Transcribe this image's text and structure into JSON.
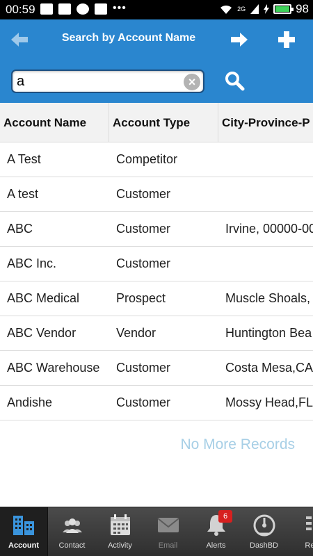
{
  "status_bar": {
    "time": "00:59",
    "signal_text": "2G",
    "battery_percent": "98",
    "battery_level": 0.98
  },
  "header": {
    "title": "Search by Account Name",
    "back_icon": "arrow-left-icon",
    "forward_icon": "arrow-right-icon",
    "add_icon": "plus-icon"
  },
  "search": {
    "value": "a",
    "clear_icon": "clear-icon",
    "search_icon": "search-icon"
  },
  "table": {
    "columns": [
      "Account Name",
      "Account Type",
      "City-Province-P"
    ],
    "rows": [
      {
        "name": "A Test",
        "type": "Competitor",
        "city": ""
      },
      {
        "name": "A test",
        "type": "Customer",
        "city": ""
      },
      {
        "name": "ABC",
        "type": "Customer",
        "city": "Irvine, 00000-00"
      },
      {
        "name": "ABC Inc.",
        "type": "Customer",
        "city": ""
      },
      {
        "name": "ABC Medical",
        "type": "Prospect",
        "city": "Muscle Shoals,"
      },
      {
        "name": "ABC Vendor",
        "type": "Vendor",
        "city": "Huntington Bea"
      },
      {
        "name": "ABC Warehouse",
        "type": "Customer",
        "city": "Costa Mesa,CA"
      },
      {
        "name": "Andishe",
        "type": "Customer",
        "city": "Mossy Head,FL"
      }
    ],
    "footer": "No More Records"
  },
  "bottom_nav": {
    "items": [
      {
        "label": "Account",
        "icon": "building-icon"
      },
      {
        "label": "Contact",
        "icon": "people-icon"
      },
      {
        "label": "Activity",
        "icon": "calendar-icon"
      },
      {
        "label": "Email",
        "icon": "envelope-icon"
      },
      {
        "label": "Alerts",
        "icon": "bell-icon",
        "badge": "6"
      },
      {
        "label": "DashBD",
        "icon": "gauge-icon"
      },
      {
        "label": "Rep",
        "icon": "reports-icon"
      }
    ]
  },
  "colors": {
    "accent": "#2a86cf",
    "badge": "#d7201f",
    "footer_text": "#a7cfe6"
  }
}
